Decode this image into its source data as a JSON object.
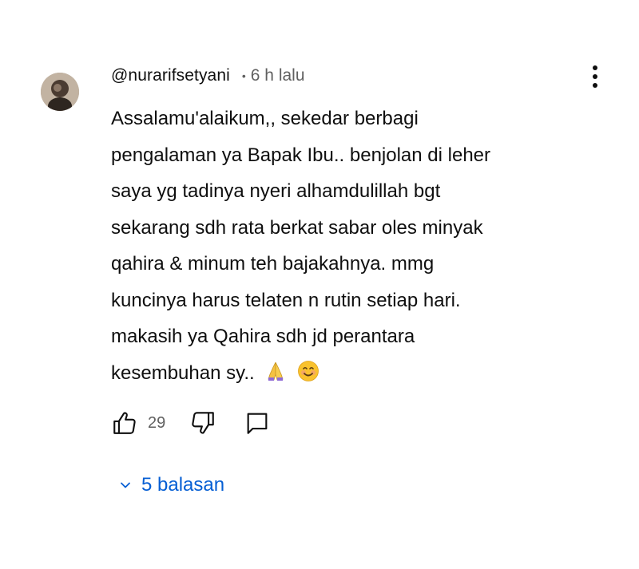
{
  "comment": {
    "author": "@nurarifsetyani",
    "separator": "•",
    "time": "6 h lalu",
    "lines": [
      "Assalamu'alaikum,, sekedar berbagi",
      "pengalaman ya Bapak Ibu.. benjolan di leher",
      "saya yg tadinya nyeri alhamdulillah bgt",
      "sekarang sdh rata berkat sabar oles minyak",
      "qahira & minum teh bajakahnya. mmg",
      "kuncinya harus telaten n rutin setiap hari.",
      "makasih ya Qahira sdh jd perantara",
      "kesembuhan sy.."
    ],
    "emojis": [
      "folded-hands-emoji",
      "smiling-face-emoji"
    ]
  },
  "actions": {
    "like_count": "29",
    "icons": [
      "thumbs-up-icon",
      "thumbs-down-icon",
      "reply-icon"
    ]
  },
  "replies": {
    "label": "5 balasan",
    "icon": "chevron-down-icon"
  },
  "colors": {
    "text": "#0f0f0f",
    "secondary": "#606060",
    "link": "#065fd4"
  }
}
